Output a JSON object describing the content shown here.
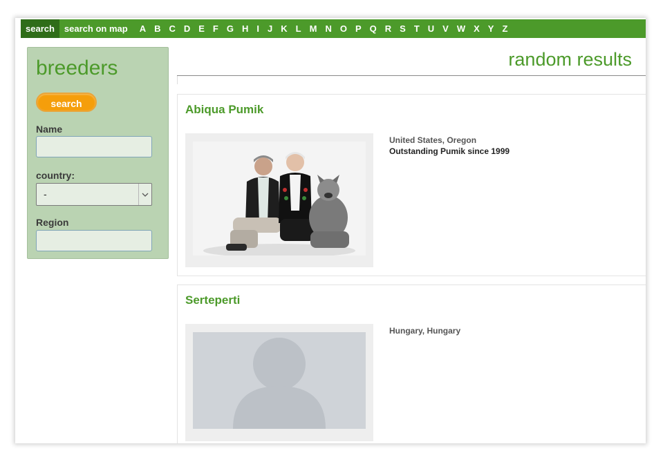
{
  "nav": {
    "search_label": "search",
    "search_on_map_label": "search on map",
    "letters": [
      "A",
      "B",
      "C",
      "D",
      "E",
      "F",
      "G",
      "H",
      "I",
      "J",
      "K",
      "L",
      "M",
      "N",
      "O",
      "P",
      "Q",
      "R",
      "S",
      "T",
      "U",
      "V",
      "W",
      "X",
      "Y",
      "Z"
    ]
  },
  "sidebar": {
    "title": "breeders",
    "search_button_label": "search",
    "name_label": "Name",
    "name_value": "",
    "country_label": "country:",
    "country_value": "-",
    "region_label": "Region",
    "region_value": ""
  },
  "results": {
    "heading": "random results",
    "items": [
      {
        "name": "Abiqua Pumik",
        "location": "United States, Oregon",
        "tagline": "Outstanding Pumik since 1999"
      },
      {
        "name": "Serteperti",
        "location": "Hungary, Hungary",
        "tagline": ""
      }
    ]
  },
  "colors": {
    "brand_green": "#4c9a2a",
    "nav_active": "#2f6d19",
    "sidebar_bg": "#bad3b2",
    "search_orange": "#f59e0b"
  },
  "icons": {
    "select_arrow": "chevron-down-icon",
    "placeholder_avatar": "avatar-placeholder-icon"
  }
}
